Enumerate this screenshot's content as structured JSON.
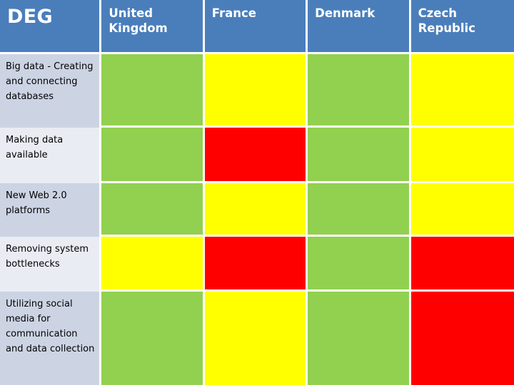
{
  "table": {
    "title": "DEG",
    "columns": [
      {
        "key": "label",
        "label": "DEG"
      },
      {
        "key": "uk",
        "label": "United Kingdom"
      },
      {
        "key": "france",
        "label": "France"
      },
      {
        "key": "denmark",
        "label": "Denmark"
      },
      {
        "key": "czech",
        "label": "Czech Republic"
      }
    ],
    "country_headers": [
      "United Kingdom",
      "France",
      "Denmark",
      "Czech Republic"
    ],
    "rows": [
      {
        "label": "Big data - Creating and connecting databases",
        "ratings": [
          "green",
          "yellow",
          "green",
          "yellow"
        ]
      },
      {
        "label": "Making data available",
        "ratings": [
          "green",
          "red",
          "green",
          "yellow"
        ]
      },
      {
        "label": "New Web 2.0 platforms",
        "ratings": [
          "green",
          "yellow",
          "green",
          "yellow"
        ]
      },
      {
        "label": "Removing system bottlenecks",
        "ratings": [
          "yellow",
          "red",
          "green",
          "red"
        ]
      },
      {
        "label": "Utilizing social media for communication and data collection",
        "ratings": [
          "green",
          "yellow",
          "green",
          "red"
        ]
      }
    ]
  },
  "legend_colors": {
    "green": "#92d050",
    "yellow": "#ffff00",
    "red": "#ff0000",
    "header_blue": "#4a7ebb",
    "label_shade_dark": "#ccd4e4",
    "label_shade_light": "#e9ecf3"
  }
}
